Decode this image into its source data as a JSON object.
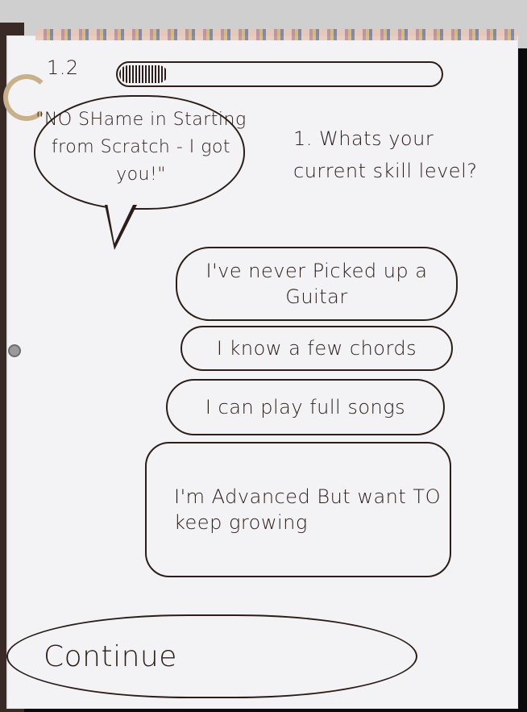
{
  "header": {
    "step": "1.2",
    "progress": 0.15
  },
  "message": {
    "text": "\"NO SHame in Starting from Scratch - I got you!\""
  },
  "question": {
    "text": "1. Whats your current skill level?"
  },
  "options": [
    {
      "label": "I've never Picked up a Guitar"
    },
    {
      "label": "I know a few chords"
    },
    {
      "label": "I can play full songs"
    },
    {
      "label": "I'm Advanced But want TO keep growing"
    }
  ],
  "actions": {
    "continue_label": "Continue"
  }
}
